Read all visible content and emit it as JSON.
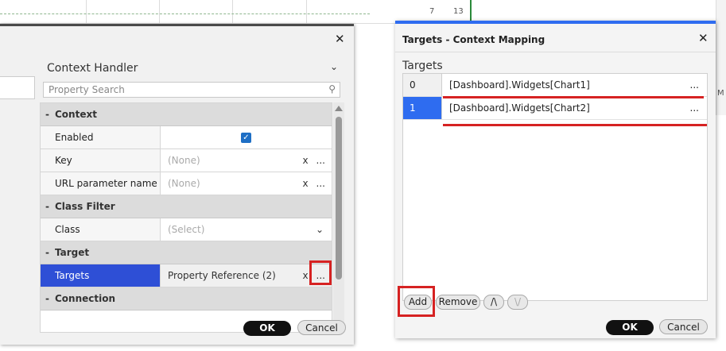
{
  "background": {
    "tick_labels": [
      "7",
      "13"
    ],
    "edge_label": "M"
  },
  "left_dialog": {
    "close_glyph": "✕",
    "handler_title": "Context Handler",
    "search_placeholder": "Property Search",
    "sections": [
      {
        "name": "Context",
        "toggle": "-"
      },
      {
        "name": "Class Filter",
        "toggle": "-"
      },
      {
        "name": "Target",
        "toggle": "-"
      },
      {
        "name": "Connection",
        "toggle": "-"
      }
    ],
    "properties": {
      "enabled": {
        "name": "Enabled",
        "checked": true
      },
      "key": {
        "name": "Key",
        "value": "(None)",
        "clear": "x",
        "more": "..."
      },
      "url_param": {
        "name": "URL parameter name",
        "value": "(None)",
        "clear": "x",
        "more": "..."
      },
      "class": {
        "name": "Class",
        "value": "(Select)"
      },
      "targets": {
        "name": "Targets",
        "value": "Property Reference (2)",
        "clear": "x",
        "more": "..."
      }
    },
    "ok_label": "OK",
    "cancel_label": "Cancel"
  },
  "right_dialog": {
    "title": "Targets - Context Mapping",
    "close_glyph": "✕",
    "targets_label": "Targets",
    "rows": [
      {
        "index": "0",
        "value": "[Dashboard].Widgets[Chart1]",
        "more": "..."
      },
      {
        "index": "1",
        "value": "[Dashboard].Widgets[Chart2]",
        "more": "..."
      }
    ],
    "add_label": "Add",
    "remove_label": "Remove",
    "up_label": "/\\",
    "down_label": "\\/",
    "ok_label": "OK",
    "cancel_label": "Cancel"
  },
  "colors": {
    "accent_blue": "#2e6cf0",
    "selection_blue": "#2e4fd6",
    "highlight_red": "#d62222"
  }
}
